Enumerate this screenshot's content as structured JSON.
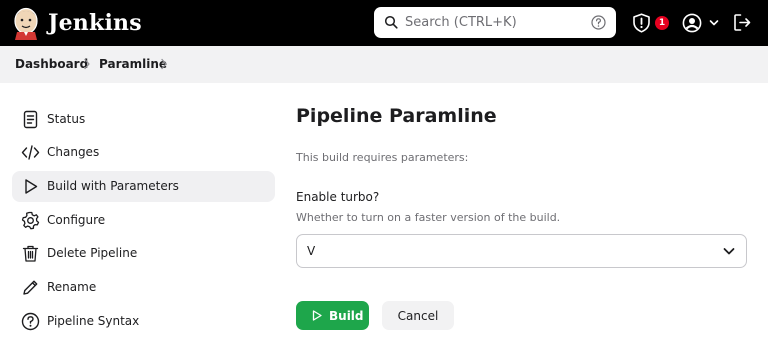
{
  "header": {
    "app_name": "Jenkins",
    "search_placeholder": "Search (CTRL+K)",
    "security_badge_count": "1",
    "badge_color": "#e6001f",
    "icons": [
      "jenkins-logo",
      "search-icon",
      "help-icon",
      "shield-alert-icon",
      "user-icon",
      "chevron-down-icon",
      "logout-icon"
    ]
  },
  "breadcrumb": {
    "items": [
      {
        "label": "Dashboard"
      },
      {
        "label": "Paramline"
      }
    ]
  },
  "sidebar": {
    "active_index": 2,
    "items": [
      {
        "label": "Status",
        "icon": "document-icon"
      },
      {
        "label": "Changes",
        "icon": "code-icon"
      },
      {
        "label": "Build with Parameters",
        "icon": "play-icon"
      },
      {
        "label": "Configure",
        "icon": "gear-icon"
      },
      {
        "label": "Delete Pipeline",
        "icon": "trash-icon"
      },
      {
        "label": "Rename",
        "icon": "pencil-icon"
      },
      {
        "label": "Pipeline Syntax",
        "icon": "question-icon"
      }
    ]
  },
  "main": {
    "title": "Pipeline Paramline",
    "requires_text": "This build requires parameters:",
    "parameter": {
      "name": "Enable turbo?",
      "description": "Whether to turn on a faster version of the build.",
      "selected_value": "V"
    },
    "build_label": "Build",
    "cancel_label": "Cancel",
    "build_color": "#1ea64b"
  }
}
